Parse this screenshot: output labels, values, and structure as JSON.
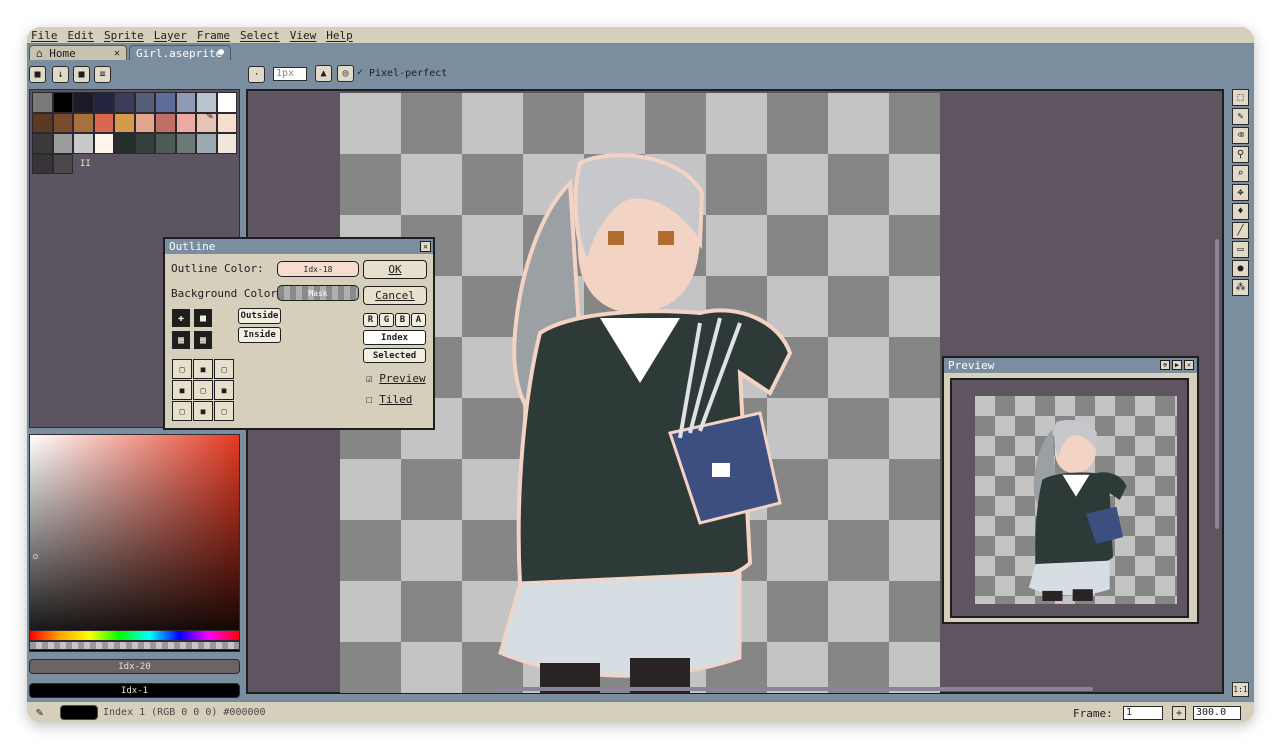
{
  "menu": [
    "File",
    "Edit",
    "Sprite",
    "Layer",
    "Frame",
    "Select",
    "View",
    "Help"
  ],
  "tabs": {
    "home": "Home",
    "file": "Girl.aseprite"
  },
  "toolbar": {
    "brush_size": "1px",
    "pixel_perfect": "Pixel-perfect",
    "icons": [
      "lock-icon",
      "down-arrow-icon",
      "square-icon",
      "menu-icon",
      "dot-icon",
      "ink-icon",
      "pressure-icon",
      "check-icon"
    ]
  },
  "palette": {
    "colors": [
      "#7a7a7a",
      "#000000",
      "#1b1b28",
      "#23243d",
      "#3a3e5a",
      "#545e78",
      "#5d6d99",
      "#8d9bb4",
      "#b9c3cf",
      "#ffffff",
      "#5c3a22",
      "#7a4b2c",
      "#a9703e",
      "#d8684f",
      "#d59a4a",
      "#e5a48c",
      "#c06f67",
      "#eea9a0",
      "#e7c3b4",
      "#f6ddd0",
      "#3a3a3a",
      "#9b9b9b",
      "#c9c9c9",
      "#fff5ea",
      "#252e2c",
      "#33403d",
      "#4d5a57",
      "#6b7a78",
      "#9eaab3",
      "#f0e6dc",
      "#3a3337",
      "#4d4548"
    ],
    "extra_marker": "II"
  },
  "color_bars": {
    "background": "Idx-20",
    "foreground": "Idx-1"
  },
  "tools": [
    "marquee-icon",
    "pencil-icon",
    "eraser-icon",
    "eyedropper-icon",
    "zoom-icon",
    "move-icon",
    "fill-icon",
    "line-icon",
    "rectangle-icon",
    "blur-icon",
    "spray-icon"
  ],
  "zoom_button": "1:1",
  "status": {
    "text": "Index 1 (RGB 0 0 0) #000000",
    "frame_label": "Frame:",
    "frame_value": "1",
    "zoom_value": "300.0"
  },
  "outline_dialog": {
    "title": "Outline",
    "outline_color_label": "Outline Color:",
    "outline_color_value": "Idx-18",
    "outline_color_hex": "#f6ddd0",
    "background_color_label": "Background Color:",
    "background_color_value": "Mask",
    "ok": "OK",
    "cancel": "Cancel",
    "outside": "Outside",
    "inside": "Inside",
    "channels": [
      "R",
      "G",
      "B",
      "A"
    ],
    "index": "Index",
    "selected": "Selected",
    "preview": "Preview",
    "tiled": "Tiled"
  },
  "preview_window": {
    "title": "Preview"
  }
}
